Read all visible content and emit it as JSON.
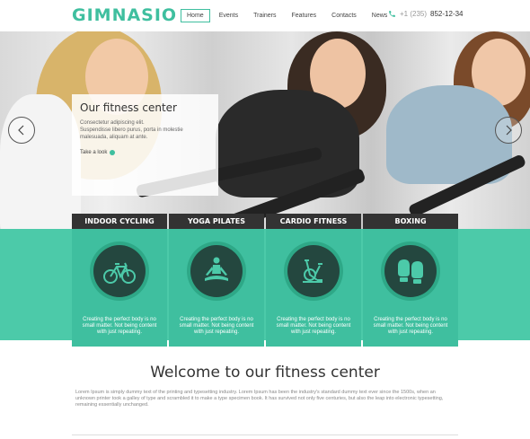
{
  "header": {
    "logo": "GIMNASIO",
    "nav": [
      {
        "label": "Home",
        "active": true
      },
      {
        "label": "Events",
        "active": false
      },
      {
        "label": "Trainers",
        "active": false
      },
      {
        "label": "Features",
        "active": false
      },
      {
        "label": "Contacts",
        "active": false
      },
      {
        "label": "News",
        "active": false
      }
    ],
    "phone_prefix": "+1 (235)",
    "phone_number": "852-12-34",
    "phone_icon": "phone-icon"
  },
  "hero": {
    "title": "Our fitness center",
    "line1": "Consectetur adipiscing elit.",
    "line2": "Suspendisse libero purus, porta in molestie",
    "line3": "malesuada, aliquam at ante.",
    "link": "Take a look",
    "prev_icon": "chevron-left-icon",
    "next_icon": "chevron-right-icon"
  },
  "categories": [
    {
      "label": "INDOOR CYCLING",
      "icon": "bicycle-icon",
      "text": "Creating the perfect body is no small matter. Not being content with just repeating."
    },
    {
      "label": "YOGA PILATES",
      "icon": "yoga-icon",
      "text": "Creating the perfect body is no small matter. Not being content with just repeating."
    },
    {
      "label": "CARDIO FITNESS",
      "icon": "exercise-bike-icon",
      "text": "Creating the perfect body is no small matter. Not being content with just repeating."
    },
    {
      "label": "BOXING",
      "icon": "boxing-gloves-icon",
      "text": "Creating the perfect body is no small matter. Not being content with just repeating."
    }
  ],
  "welcome": {
    "title": "Welcome to our fitness center",
    "text": "Lorem Ipsum is simply dummy text of the printing and typesetting industry. Lorem Ipsum has been the industry's standard dummy text ever since the 1500s, when an unknown printer took a galley of type and scrambled it to make a type specimen book. It has survived not only five centuries, but also the leap into electronic typesetting, remaining essentially unchanged."
  },
  "colors": {
    "accent": "#3fbf9f",
    "band": "#4ccaa9",
    "dark": "#333333"
  }
}
